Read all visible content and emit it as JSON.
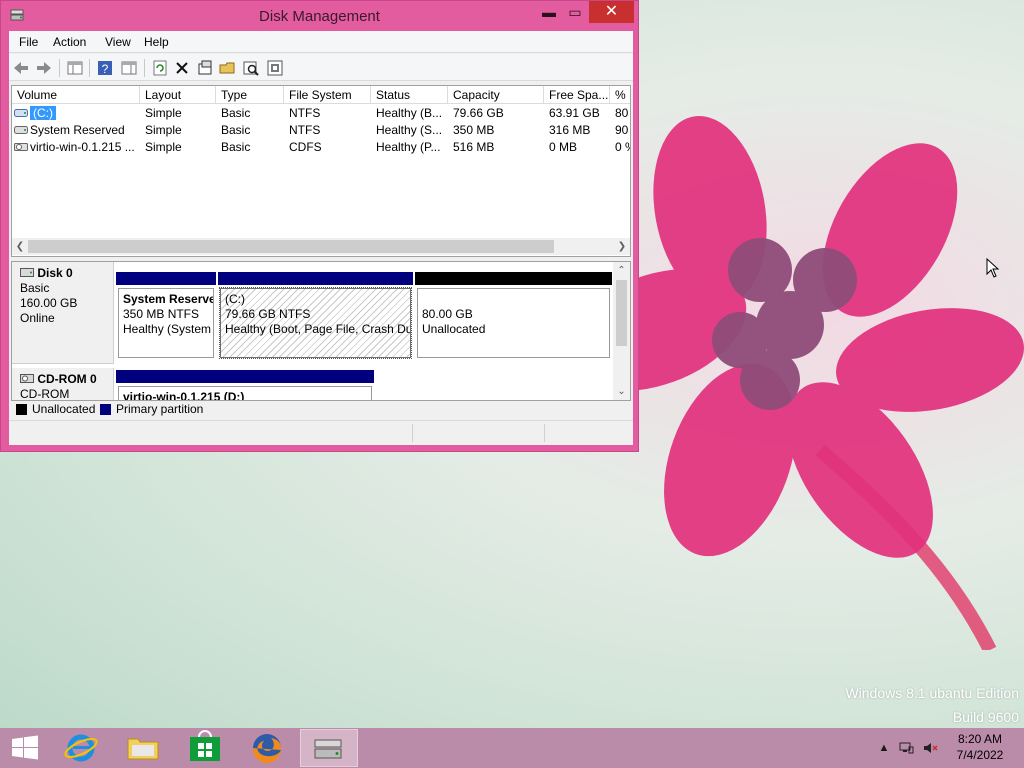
{
  "window": {
    "title": "Disk Management",
    "controls": {
      "minimize": "▬",
      "maximize": "▭",
      "close": "✕"
    }
  },
  "menu": [
    "File",
    "Action",
    "View",
    "Help"
  ],
  "toolbar_icons": [
    "back-icon",
    "forward-icon",
    "show-hide-console-tree-icon",
    "help-icon",
    "properties-pane-icon",
    "refresh-icon",
    "delete-icon",
    "properties-icon",
    "open-icon",
    "rescan-disks-icon",
    "settings-icon"
  ],
  "volumes": {
    "columns": [
      "Volume",
      "Layout",
      "Type",
      "File System",
      "Status",
      "Capacity",
      "Free Spa...",
      "% F"
    ],
    "rows": [
      {
        "volume": "(C:)",
        "layout": "Simple",
        "type": "Basic",
        "fs": "NTFS",
        "status": "Healthy (B...",
        "capacity": "79.66 GB",
        "free": "63.91 GB",
        "pct": "80"
      },
      {
        "volume": "System Reserved",
        "layout": "Simple",
        "type": "Basic",
        "fs": "NTFS",
        "status": "Healthy (S...",
        "capacity": "350 MB",
        "free": "316 MB",
        "pct": "90"
      },
      {
        "volume": "virtio-win-0.1.215 ...",
        "layout": "Simple",
        "type": "Basic",
        "fs": "CDFS",
        "status": "Healthy (P...",
        "capacity": "516 MB",
        "free": "0 MB",
        "pct": "0 %"
      }
    ]
  },
  "disks": {
    "disk0": {
      "name": "Disk 0",
      "type": "Basic",
      "size": "160.00 GB",
      "state": "Online",
      "partitions": [
        {
          "name": "System Reserve",
          "size": "350 MB NTFS",
          "status": "Healthy (System"
        },
        {
          "name": "(C:)",
          "size": "79.66 GB NTFS",
          "status": "Healthy (Boot, Page File, Crash Du"
        },
        {
          "size": "80.00 GB",
          "status": "Unallocated"
        }
      ]
    },
    "cdrom0": {
      "name": "CD-ROM 0",
      "type": "CD-ROM",
      "partitions": [
        {
          "name": "virtio-win-0.1.215  (D:)"
        }
      ]
    }
  },
  "legend": {
    "unallocated": "Unallocated",
    "primary": "Primary partition"
  },
  "colors": {
    "unallocated": "#000000",
    "primary": "#00007f",
    "window_frame": "#e35c9f",
    "taskbar": "#bb8ca9",
    "close_button": "#c7302e"
  },
  "desktop": {
    "watermark_line1": "Windows 8.1 ubantu Edition",
    "watermark_line2": "Build 9600"
  },
  "taskbar": {
    "items": [
      "start-button",
      "internet-explorer-icon",
      "file-explorer-icon",
      "store-icon",
      "firefox-icon",
      "disk-management-icon"
    ],
    "tray": [
      "show-hidden-icons",
      "network-icon",
      "volume-muted-icon"
    ],
    "time": "8:20 AM",
    "date": "7/4/2022"
  }
}
